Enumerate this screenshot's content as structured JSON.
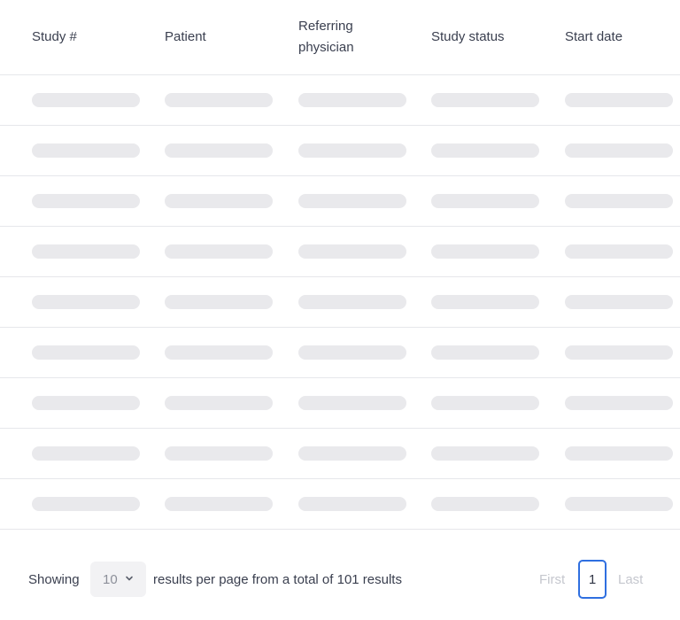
{
  "table": {
    "columns": [
      "Study #",
      "Patient",
      "Referring physician",
      "Study status",
      "Start date"
    ],
    "loading_rows": 9
  },
  "footer": {
    "showing_label": "Showing",
    "per_page_value": "10",
    "results_text": "results per page from a total of 101 results",
    "pagination": {
      "first_label": "First",
      "current_page": "1",
      "last_label": "Last"
    }
  },
  "colors": {
    "skeleton": "#e9e9ec",
    "accent": "#2f6fe0",
    "divider": "#e6e7eb"
  }
}
